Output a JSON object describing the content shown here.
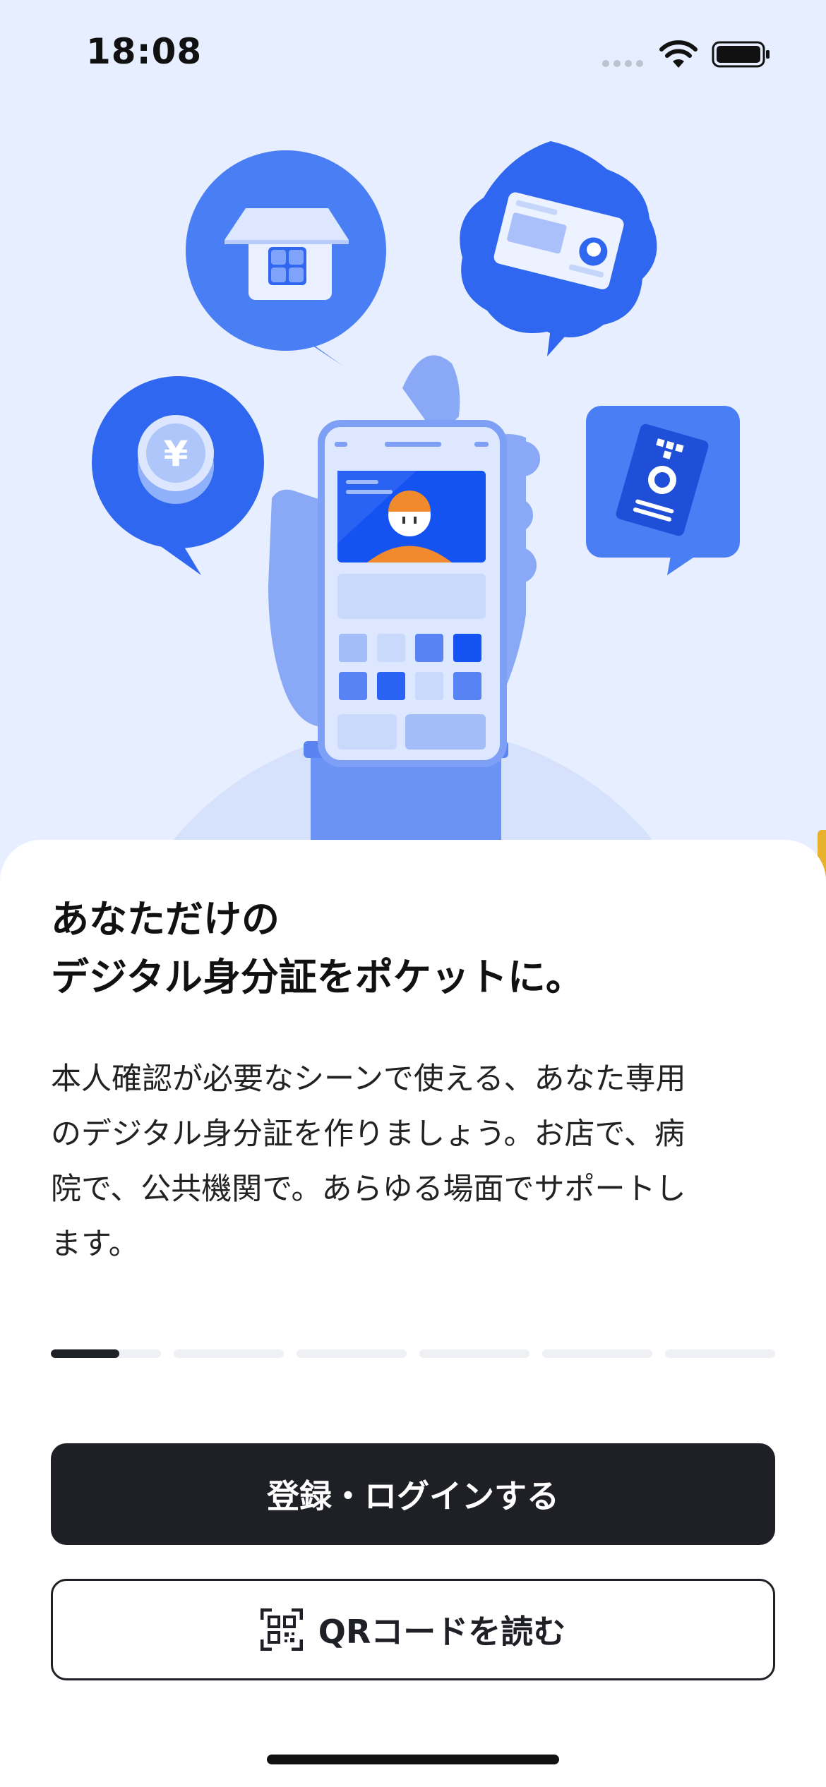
{
  "status_bar": {
    "time": "18:08"
  },
  "onboarding": {
    "headline": [
      "あなただけの",
      "デジタル身分証をポケットに。"
    ],
    "body": [
      "本人確認が必要なシーンで使える、あなた専用",
      "のデジタル身分証を作りましょう。お店で、病",
      "院で、公共機関で。あらゆる場面でサポートし",
      "ます。"
    ],
    "page_indicator": {
      "total_pages": 6,
      "current_page": 1,
      "current_progress": 0.62
    }
  },
  "actions": {
    "login_label": "登録・ログインする",
    "qr_label": "QRコードを読む"
  },
  "icons": {
    "hero": "phone-in-hand-illustration",
    "qr": "qr-code-icon",
    "wifi": "wifi-icon",
    "battery": "battery-icon",
    "signal": "signal-icon"
  },
  "colors": {
    "background": "#E6EEFF",
    "primary_blue": "#2F67F0",
    "button_dark": "#1E2026",
    "accent_tab": "#E8B12E"
  }
}
